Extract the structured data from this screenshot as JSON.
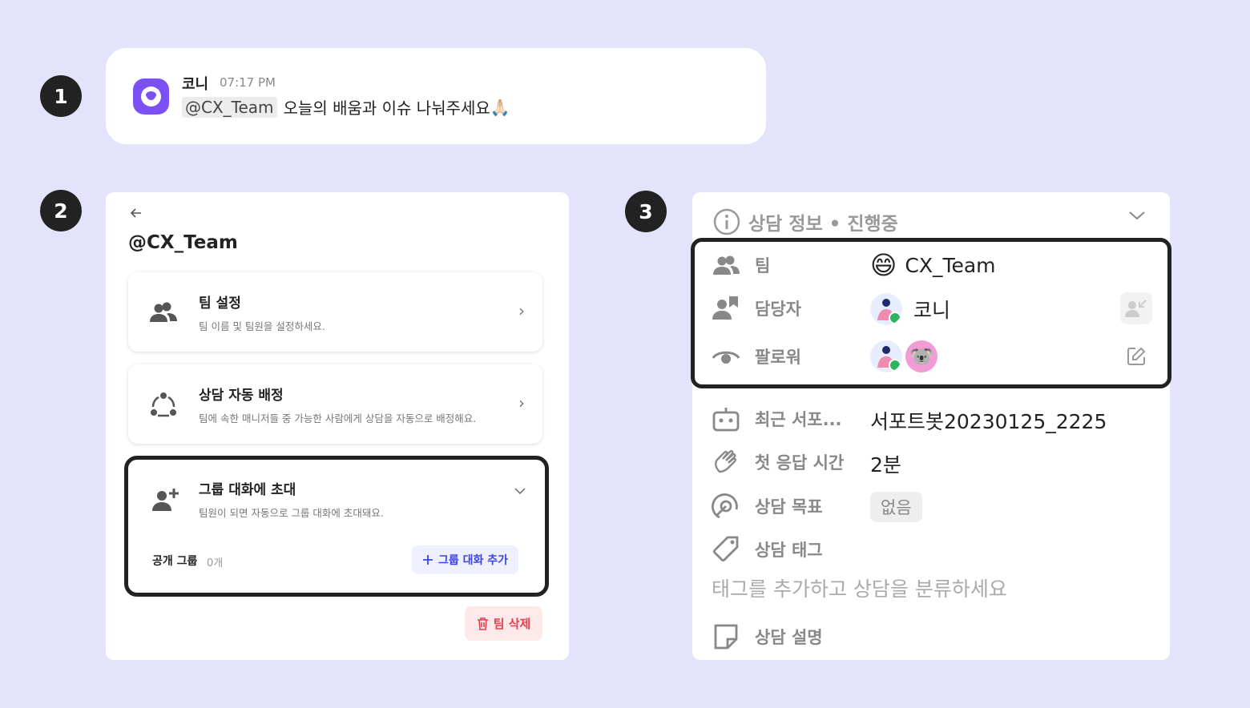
{
  "steps": [
    "1",
    "2",
    "3"
  ],
  "message": {
    "author": "코니",
    "time": "07:17 PM",
    "mention": "@CX_Team",
    "text": "오늘의 배움과 이슈 나눠주세요",
    "emoji": "🙏🏻"
  },
  "team_panel": {
    "back_icon": "arrow-left-icon",
    "title": "@CX_Team",
    "cards": [
      {
        "title": "팀 설정",
        "subtitle": "팀 이름 및 팀원을 설정하세요.",
        "icon": "people-icon"
      },
      {
        "title": "상담 자동 배정",
        "subtitle": "팀에 속한 매니저들 중 가능한 사람에게 상담을 자동으로 배정해요.",
        "icon": "auto-assign-icon"
      },
      {
        "title": "그룹 대화에 초대",
        "subtitle": "팀원이 되면 자동으로 그룹 대화에 초대돼요.",
        "icon": "add-person-icon"
      }
    ],
    "group_label": "공개 그룹",
    "group_count": "0개",
    "add_group_label": "그룹 대화 추가",
    "delete_label": "팀 삭제"
  },
  "info_panel": {
    "header": "상담 정보 • 진행중",
    "team_label": "팀",
    "team_emoji": "😄",
    "team_value": "CX_Team",
    "assignee_label": "담당자",
    "assignee_value": "코니",
    "follower_label": "팔로워",
    "follower_emoji": "🐨",
    "recent_label": "최근 서포...",
    "recent_value": "서포트봇20230125_2225",
    "first_response_label": "첫 응답 시간",
    "first_response_value": "2분",
    "goal_label": "상담 목표",
    "goal_value": "없음",
    "tag_label": "상담 태그",
    "tag_hint": "태그를 추가하고 상담을 분류하세요",
    "desc_label": "상담 설명"
  },
  "colors": {
    "background": "#e3e3fb",
    "brand": "#7b50f5",
    "accent": "#3b44e0",
    "danger": "#e5414f"
  }
}
